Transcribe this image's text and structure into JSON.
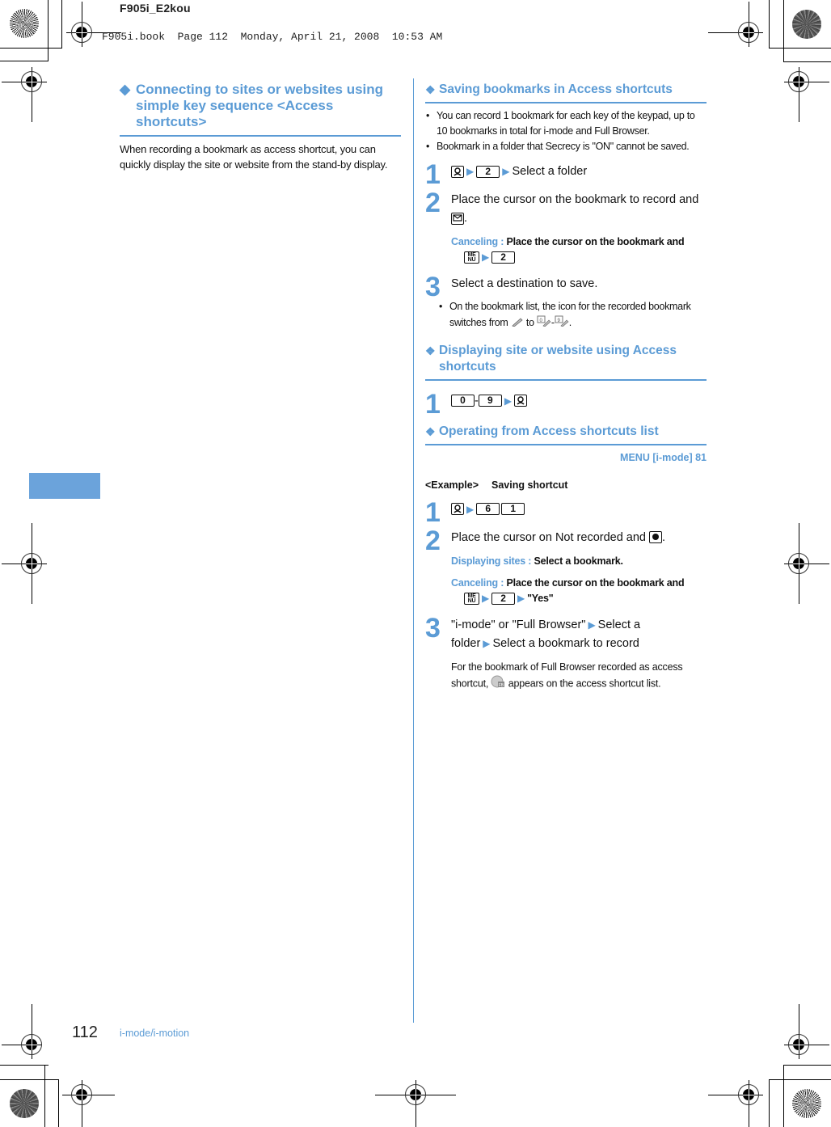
{
  "header": {
    "file_name": "F905i_E2kou",
    "book_info": "F905i.book  Page 112  Monday, April 21, 2008  10:53 AM"
  },
  "left": {
    "section_marker": "◆",
    "section_title_line1": "Connecting to sites or websites using",
    "section_title_line2": "simple key sequence <Access shortcuts>",
    "intro": "When recording a bookmark as access shortcut, you can quickly display the site or website from the stand-by display."
  },
  "right": {
    "sub_marker": "❖",
    "saving": {
      "title": "Saving bookmarks in Access shortcuts",
      "bullets": [
        "You can record 1 bookmark for each key of the keypad, up to 10 bookmarks in total for i-mode and Full Browser.",
        "Bookmark in a folder that Secrecy is \"ON\" cannot be saved."
      ],
      "steps": [
        {
          "num": "1",
          "key1": "i-mode-key-icon",
          "key2": "2",
          "text": "Select a folder"
        },
        {
          "num": "2",
          "text": "Place the cursor on the bookmark to record and",
          "key": "mail-key-icon",
          "tail": "."
        },
        {
          "num": "3",
          "text": "Select a destination to save."
        }
      ],
      "cancel_label": "Canceling : ",
      "cancel_text": "Place the cursor on the bookmark and",
      "cancel_key_menu": "ME NU",
      "cancel_key": "2",
      "step3_bullet_a": "On the bookmark list, the icon for the recorded bookmark switches from",
      "step3_bullet_to": "to",
      "step3_bullet_dash": "-",
      "step3_bullet_end": "."
    },
    "displaying": {
      "title_line1": "Displaying site or website using Access",
      "title_line2": "shortcuts",
      "step1": {
        "num": "1",
        "key_from": "0",
        "dash": "-",
        "key_to": "9"
      }
    },
    "operating": {
      "title": "Operating from Access shortcuts list",
      "menu_path": "MENU [i-mode] 81",
      "example_label": "<Example>",
      "example_text": "Saving shortcut",
      "step1": {
        "num": "1",
        "key1": "6",
        "key2": "1"
      },
      "step2": {
        "num": "2",
        "text": "Place the cursor on Not recorded and",
        "tail": "."
      },
      "display_label": "Displaying sites : ",
      "display_text": "Select a bookmark.",
      "cancel_label": "Canceling : ",
      "cancel_text": "Place the cursor on the bookmark and",
      "cancel_key_menu": "ME NU",
      "cancel_key": "2",
      "cancel_yes": "\"Yes\"",
      "step3": {
        "num": "3",
        "part1": "\"i-mode\" or \"Full Browser\"",
        "part2": "Select a",
        "part3": "folder",
        "part4": "Select a bookmark to record"
      },
      "note": "For the bookmark of Full Browser recorded as access shortcut,",
      "note_tail": "appears on the access shortcut list."
    }
  },
  "footer": {
    "page_number": "112",
    "section": "i-mode/i-motion"
  },
  "colors": {
    "accent": "#5b9bd5",
    "side_tab": "#6ba3db"
  }
}
